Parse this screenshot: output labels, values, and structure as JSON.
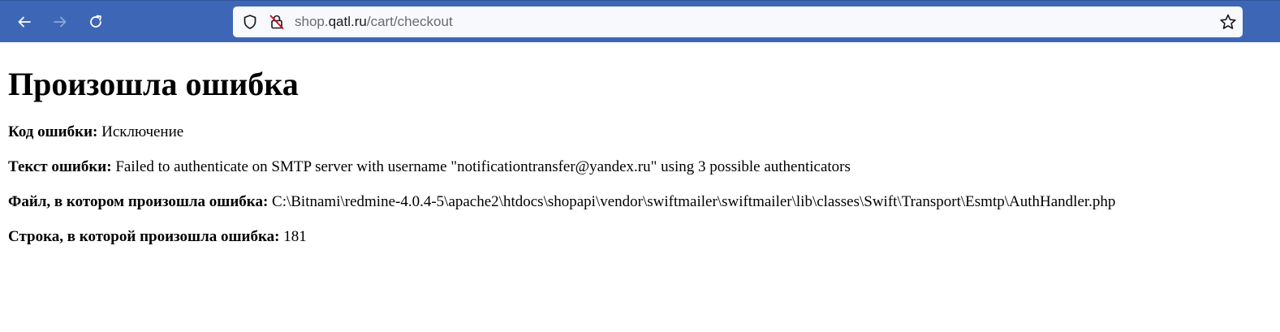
{
  "browser": {
    "url_host_prefix": "shop.",
    "url_domain": "qatl.ru",
    "url_path": "/cart/checkout",
    "toolbar_color": "#3d67b6",
    "icons": {
      "back": "back-arrow-icon",
      "forward": "forward-arrow-icon",
      "reload": "reload-icon",
      "shield": "shield-icon",
      "lock": "insecure-lock-icon",
      "bookmark": "star-icon"
    }
  },
  "page": {
    "heading": "Произошла ошибка",
    "fields": [
      {
        "label": "Код ошибки:",
        "value": " Исключение"
      },
      {
        "label": "Текст ошибки:",
        "value": " Failed to authenticate on SMTP server with username \"notificationtransfer@yandex.ru\" using 3 possible authenticators"
      },
      {
        "label": "Файл, в котором произошла ошибка:",
        "value": " C:\\Bitnami\\redmine-4.0.4-5\\apache2\\htdocs\\shopapi\\vendor\\swiftmailer\\swiftmailer\\lib\\classes\\Swift\\Transport\\Esmtp\\AuthHandler.php"
      },
      {
        "label": "Строка, в которой произошла ошибка:",
        "value": " 181"
      }
    ]
  }
}
